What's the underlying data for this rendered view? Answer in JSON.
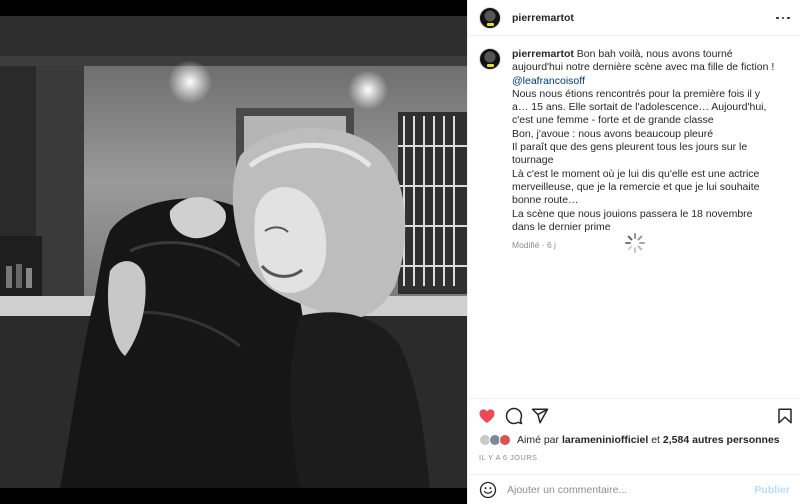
{
  "post": {
    "username": "pierremartot",
    "caption": {
      "username": "pierremartot",
      "line1": "Bon bah voilà, nous avons tourné aujourd'hui notre dernière scène avec ma fille de fiction !",
      "mention": "@leafrancoisoff",
      "p1": "Nous nous étions rencontrés pour la première fois il y a… 15 ans. Elle sortait de l'adolescence… Aujourd'hui, c'est une femme - forte et de grande classe",
      "p2": "Bon, j'avoue : nous avons beaucoup pleuré",
      "p3": "Il paraît que des gens pleurent tous les jours sur le tournage",
      "p4": "Là c'est le moment où je lui dis qu'elle est une actrice merveilleuse, que je la remercie et que je lui souhaite bonne route…",
      "p5": "La scène que nous jouions passera le 18 novembre dans le dernier prime"
    },
    "modified": "Modifié · 6 j",
    "likes": {
      "prefix": "Aimé par",
      "user": "larameniniofficiel",
      "conj": "et",
      "others": "2,584 autres personnes"
    },
    "date": "IL Y A 6 JOURS",
    "comment_placeholder": "Ajouter un commentaire...",
    "publish_label": "Publier",
    "liked": true
  },
  "icons": {
    "more": "more-options-icon",
    "like": "heart-icon",
    "comment": "comment-icon",
    "share": "share-icon",
    "save": "bookmark-icon",
    "emoji": "emoji-icon",
    "spinner": "loading-spinner-icon"
  },
  "colors": {
    "like": "#ed4956",
    "mention": "#00376b",
    "publish_disabled": "#b2dffc",
    "secondary_text": "#8e8e8e"
  }
}
